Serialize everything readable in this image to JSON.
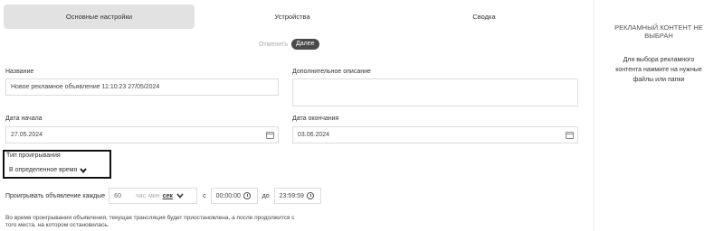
{
  "tabs": [
    {
      "label": "Основные настройки",
      "active": true
    },
    {
      "label": "Устройства",
      "active": false
    },
    {
      "label": "Сводка",
      "active": false
    }
  ],
  "actions": {
    "cancel": "Отменить",
    "next": "Далее"
  },
  "form": {
    "name_label": "Название",
    "name_value": "Новое рекламное объявление 11:10:23 27/05/2024",
    "desc_label": "Дополнительное описание",
    "desc_value": "",
    "start_label": "Дата начала",
    "start_value": "27.05.2024",
    "end_label": "Дата окончания",
    "end_value": "03.06.2024",
    "type_label": "Тип проигрывания",
    "type_value": "В определенное время"
  },
  "repeat": {
    "label": "Проигрывать объявление каждые",
    "value": "60",
    "units": [
      "час",
      "мин",
      "сек"
    ],
    "selected_unit": "сек",
    "from_label": "с",
    "from_value": "00:00:00",
    "to_label": "до",
    "to_value": "23:59:59"
  },
  "note": "Во время проигрывания объявления, текущая трансляция будет приостановлена, а после продолжится с того места, на котором остановилась.",
  "right_panel": {
    "title": "РЕКЛАМНЫЙ КОНТЕНТ НЕ ВЫБРАН",
    "text": "Для выбора рекламного контента нажмите на нужные файлы или папки"
  }
}
